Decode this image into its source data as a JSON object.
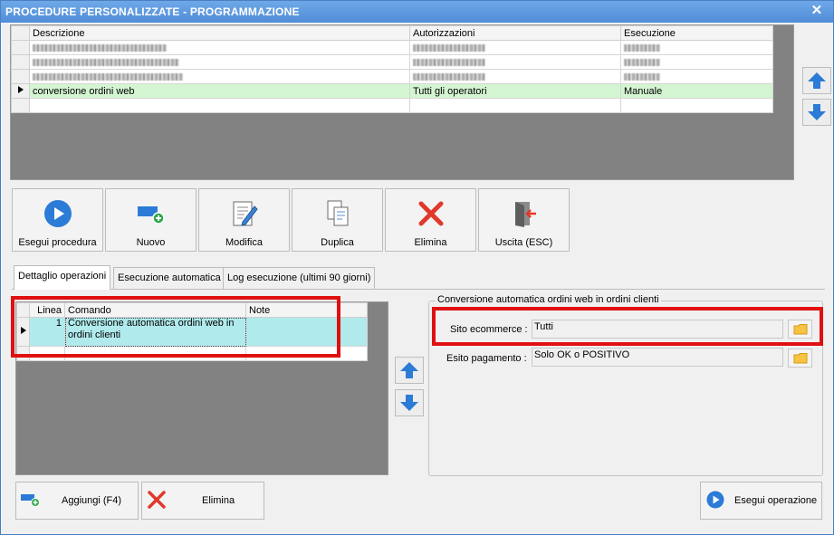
{
  "window": {
    "title": "PROCEDURE PERSONALIZZATE -  PROGRAMMAZIONE",
    "close_glyph": "✕"
  },
  "procedures_grid": {
    "columns": [
      "Descrizione",
      "Autorizzazioni",
      "Esecuzione"
    ],
    "selected_row": {
      "descrizione": "conversione ordini web",
      "autorizzazioni": "Tutti gli operatori",
      "esecuzione": "Manuale"
    }
  },
  "toolbar": {
    "buttons": [
      {
        "label": "Esegui procedura",
        "icon": "play-icon"
      },
      {
        "label": "Nuovo",
        "icon": "new-icon"
      },
      {
        "label": "Modifica",
        "icon": "edit-icon"
      },
      {
        "label": "Duplica",
        "icon": "duplicate-icon"
      },
      {
        "label": "Elimina",
        "icon": "delete-icon"
      },
      {
        "label": "Uscita (ESC)",
        "icon": "exit-icon"
      }
    ]
  },
  "tabs": [
    {
      "label": "Dettaglio operazioni",
      "active": true
    },
    {
      "label": "Esecuzione automatica",
      "active": false
    },
    {
      "label": "Log esecuzione (ultimi 90 giorni)",
      "active": false
    }
  ],
  "operations_grid": {
    "columns": [
      "Linea",
      "Comando",
      "Note"
    ],
    "rows": [
      {
        "linea": "1",
        "comando": "Conversione automatica ordini web in ordini clienti",
        "note": ""
      }
    ]
  },
  "detail": {
    "group_title": "Conversione automatica ordini web in ordini clienti",
    "sito_label": "Sito ecommerce :",
    "sito_value": "Tutti",
    "esito_label": "Esito pagamento :",
    "esito_value": "Solo OK o POSITIVO"
  },
  "bottom_buttons": {
    "aggiungi": "Aggiungi (F4)",
    "elimina": "Elimina",
    "esegui_operazione": "Esegui operazione"
  },
  "colors": {
    "accent_blue": "#2c7bd6",
    "highlight_red": "#e01010",
    "selected_row_green": "#d3f5d1",
    "selected_row_cyan": "#b0eaec"
  }
}
